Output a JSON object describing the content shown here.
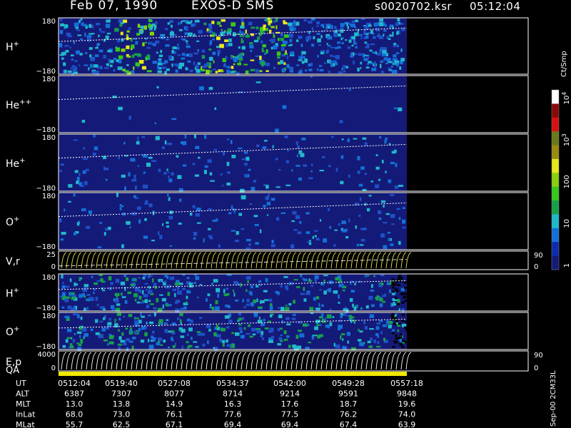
{
  "header": {
    "date": "Feb 07, 1990",
    "title": "EXOS-D SMS",
    "file": "s0020702.ksr",
    "time": "05:12:04"
  },
  "chart_data": {
    "type": "heatmap",
    "panels": [
      {
        "id": "h1",
        "label": "H",
        "sup": "+",
        "ticks": [
          "180",
          "−180"
        ]
      },
      {
        "id": "hepp",
        "label": "He",
        "sup": "++",
        "ticks": [
          "180",
          "−180"
        ]
      },
      {
        "id": "hep",
        "label": "He",
        "sup": "+",
        "ticks": [
          "180",
          "−180"
        ]
      },
      {
        "id": "o1",
        "label": "O",
        "sup": "+",
        "ticks": [
          "180",
          "−180"
        ]
      },
      {
        "id": "vr",
        "label": "V,r",
        "sup": "",
        "ticks": [
          "25",
          "0"
        ],
        "right_ticks": [
          "90",
          "0"
        ]
      },
      {
        "id": "h2",
        "label": "H",
        "sup": "+",
        "ticks": [
          "180",
          "−180"
        ]
      },
      {
        "id": "o2",
        "label": "O",
        "sup": "+",
        "ticks": [
          "180",
          "−180"
        ]
      },
      {
        "id": "ep",
        "label": "E,p",
        "sup": "",
        "ticks": [
          "4000",
          "0"
        ],
        "right_ticks": [
          "90",
          "0"
        ]
      }
    ],
    "qa_label": "QA",
    "colorbar": {
      "unit": "Ct/Smp",
      "labels": [
        {
          "base": "10",
          "exp": "4",
          "value": 10000
        },
        {
          "base": "10",
          "exp": "3",
          "value": 1000
        },
        {
          "base": "100",
          "exp": "",
          "value": 100
        },
        {
          "base": "10",
          "exp": "",
          "value": 10
        },
        {
          "base": "1",
          "exp": "",
          "value": 1
        }
      ],
      "colors": [
        "#141a78",
        "#0e2cb0",
        "#1470d8",
        "#20b8cc",
        "#16a04a",
        "#36c81a",
        "#88d010",
        "#e8e81a",
        "#9a8a10",
        "#6a7a1a",
        "#d81010",
        "#8a0a0a",
        "#ffffff"
      ]
    },
    "footer": {
      "side_label": "Sep-00 2CM33L",
      "rows": [
        {
          "label": "UT",
          "values": [
            "0512:04",
            "0519:40",
            "0527:08",
            "0534:37",
            "0542:00",
            "0549:28",
            "0557:18"
          ]
        },
        {
          "label": "ALT",
          "values": [
            "6387",
            "7307",
            "8077",
            "8714",
            "9214",
            "9591",
            "9848"
          ]
        },
        {
          "label": "MLT",
          "values": [
            "13.0",
            "13.8",
            "14.9",
            "16.3",
            "17.6",
            "18.7",
            "19.6"
          ]
        },
        {
          "label": "InLat",
          "values": [
            "68.0",
            "73.0",
            "76.1",
            "77.6",
            "77.5",
            "76.2",
            "74.0"
          ]
        },
        {
          "label": "MLat",
          "values": [
            "55.7",
            "62.5",
            "67.1",
            "69.4",
            "69.4",
            "67.4",
            "63.9"
          ]
        }
      ]
    }
  }
}
